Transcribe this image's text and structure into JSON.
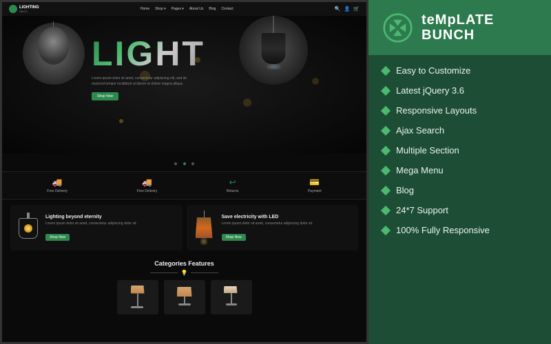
{
  "brand": {
    "name": "teMpLATE BUNCH"
  },
  "navbar": {
    "logo": "LIGHTING",
    "logo_sub": "DECO",
    "links": [
      "Home",
      "Shop",
      "Pages",
      "About Us",
      "Blog",
      "Contact"
    ]
  },
  "hero": {
    "title": "LIGHT",
    "description": "Lorem ipsum dolor sit amet, consectetur adipiscing elit, sed do eiusmod tempor incididunt ut labore et dolore magna aliqua.",
    "button": "Shop Now"
  },
  "features": [
    {
      "icon": "🚚",
      "label": "Free Delivery"
    },
    {
      "icon": "🚚",
      "label": "Free Delivery"
    },
    {
      "icon": "↩",
      "label": "Returns"
    },
    {
      "icon": "💳",
      "label": "Payment"
    }
  ],
  "products": [
    {
      "title": "Lighting beyond eternity",
      "description": "Lorem ipsum dolor sit amet, consectetur adipiscing dolor sit.",
      "button": "Shop Now"
    },
    {
      "title": "Save electricity with LED",
      "description": "Lorem ipsum dolor sit amet, consectetur adipiscing dolor sit.",
      "button": "Shop Now"
    }
  ],
  "categories": {
    "title": "Categories Features"
  },
  "feature_list": [
    "Easy to Customize",
    "Latest jQuery 3.6",
    "Responsive Layouts",
    "Ajax Search",
    "Multiple Section",
    "Mega Menu",
    "Blog",
    "24*7 Support",
    "100% Fully Responsive"
  ]
}
